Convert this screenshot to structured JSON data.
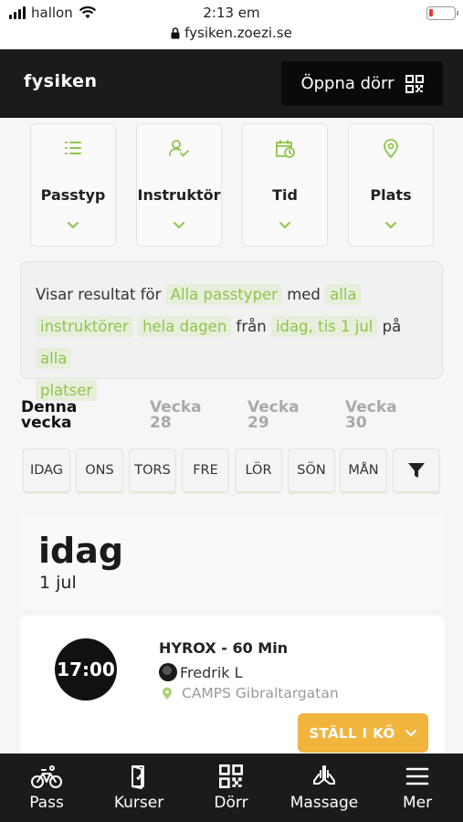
{
  "status_bar": {
    "carrier": "hallon",
    "time": "2:13 em",
    "url": "fysiken.zoezi.se"
  },
  "header": {
    "logo": "fysiken",
    "open_door_label": "Öppna dörr"
  },
  "filters": [
    {
      "label": "Passtyp",
      "icon": "list-icon"
    },
    {
      "label": "Instruktör",
      "icon": "user-check-icon"
    },
    {
      "label": "Tid",
      "icon": "calendar-clock-icon"
    },
    {
      "label": "Plats",
      "icon": "location-pin-icon"
    }
  ],
  "summary": {
    "t1": "Visar resultat för",
    "passtyp": "Alla passtyper",
    "t2": "med",
    "instr_a": "alla",
    "instr_b": "instruktörer",
    "tid": "hela dagen",
    "t3": "från",
    "datum": "idag, tis 1 jul",
    "t4": "på",
    "plats_a": "alla",
    "plats_b": "platser"
  },
  "weeks": [
    {
      "line1": "Denna",
      "line2": "vecka"
    },
    {
      "line1": "Vecka",
      "line2": "28"
    },
    {
      "line1": "Vecka",
      "line2": "29"
    },
    {
      "line1": "Vecka",
      "line2": "30"
    }
  ],
  "days": [
    "IDAG",
    "ONS",
    "TORS",
    "FRE",
    "LÖR",
    "SÖN",
    "MÅN"
  ],
  "date_header": {
    "day": "idag",
    "date": "1 jul"
  },
  "class": {
    "time": "17:00",
    "title": "HYROX - 60 Min",
    "instructor": "Fredrik L",
    "location": "CAMPS Gibraltargatan",
    "queue_label": "STÄLL I KÖ"
  },
  "nav": [
    {
      "label": "Pass",
      "icon": "bicycle-icon"
    },
    {
      "label": "Kurser",
      "icon": "door-icon"
    },
    {
      "label": "Dörr",
      "icon": "qr-code-icon"
    },
    {
      "label": "Massage",
      "icon": "praying-hands-icon"
    },
    {
      "label": "Mer",
      "icon": "menu-icon"
    }
  ],
  "colors": {
    "accent": "#8fc44a",
    "header_bg": "#1b1b1b",
    "queue_button": "#f1b43d",
    "battery_low": "#e53a35"
  }
}
